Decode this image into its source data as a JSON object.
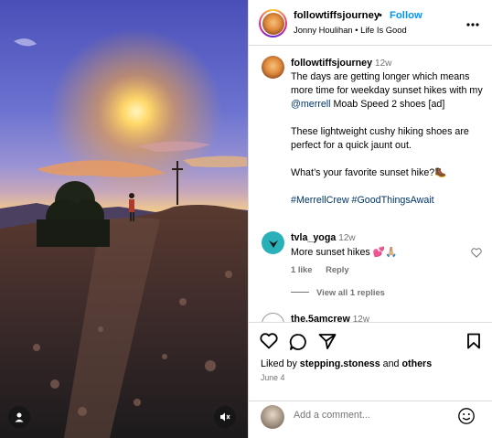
{
  "header": {
    "username": "followtiffsjourney",
    "separator": "•",
    "follow_label": "Follow",
    "subtitle": "Jonny Houlihan • Life Is Good"
  },
  "caption": {
    "username": "followtiffsjourney",
    "time": "12w",
    "text_1": "The days are getting longer which means more time for weekday sunset hikes with my",
    "mention": "@merrell",
    "text_2": "Moab Speed 2 shoes [ad]",
    "para_2": "These lightweight cushy hiking shoes are perfect for a quick jaunt out.",
    "para_3": "What’s your favorite sunset hike?🥾",
    "hashtags": "#MerrellCrew #GoodThingsAwait"
  },
  "comments": [
    {
      "username": "tvla_yoga",
      "time": "12w",
      "text": "More sunset hikes 💕🙏🏼",
      "likes": "1 like",
      "reply_label": "Reply",
      "view_replies": "View all 1 replies"
    },
    {
      "username": "the.5amcrew",
      "time": "12w"
    }
  ],
  "actions": {
    "liked_by_prefix": "Liked by",
    "liked_by_user": "stepping.stoness",
    "and": "and",
    "others": "others",
    "date": "June 4"
  },
  "add_comment": {
    "placeholder": "Add a comment..."
  },
  "icons": {
    "more": "more-horizontal-icon",
    "like": "heart-icon",
    "comment": "comment-icon",
    "share": "share-icon",
    "save": "bookmark-icon",
    "emoji": "emoji-icon",
    "tag": "user-tag-icon",
    "mute": "mute-icon"
  },
  "colors": {
    "accent": "#0095f6",
    "link": "#00376b",
    "muted": "#737373",
    "border": "#dbdbdb"
  }
}
